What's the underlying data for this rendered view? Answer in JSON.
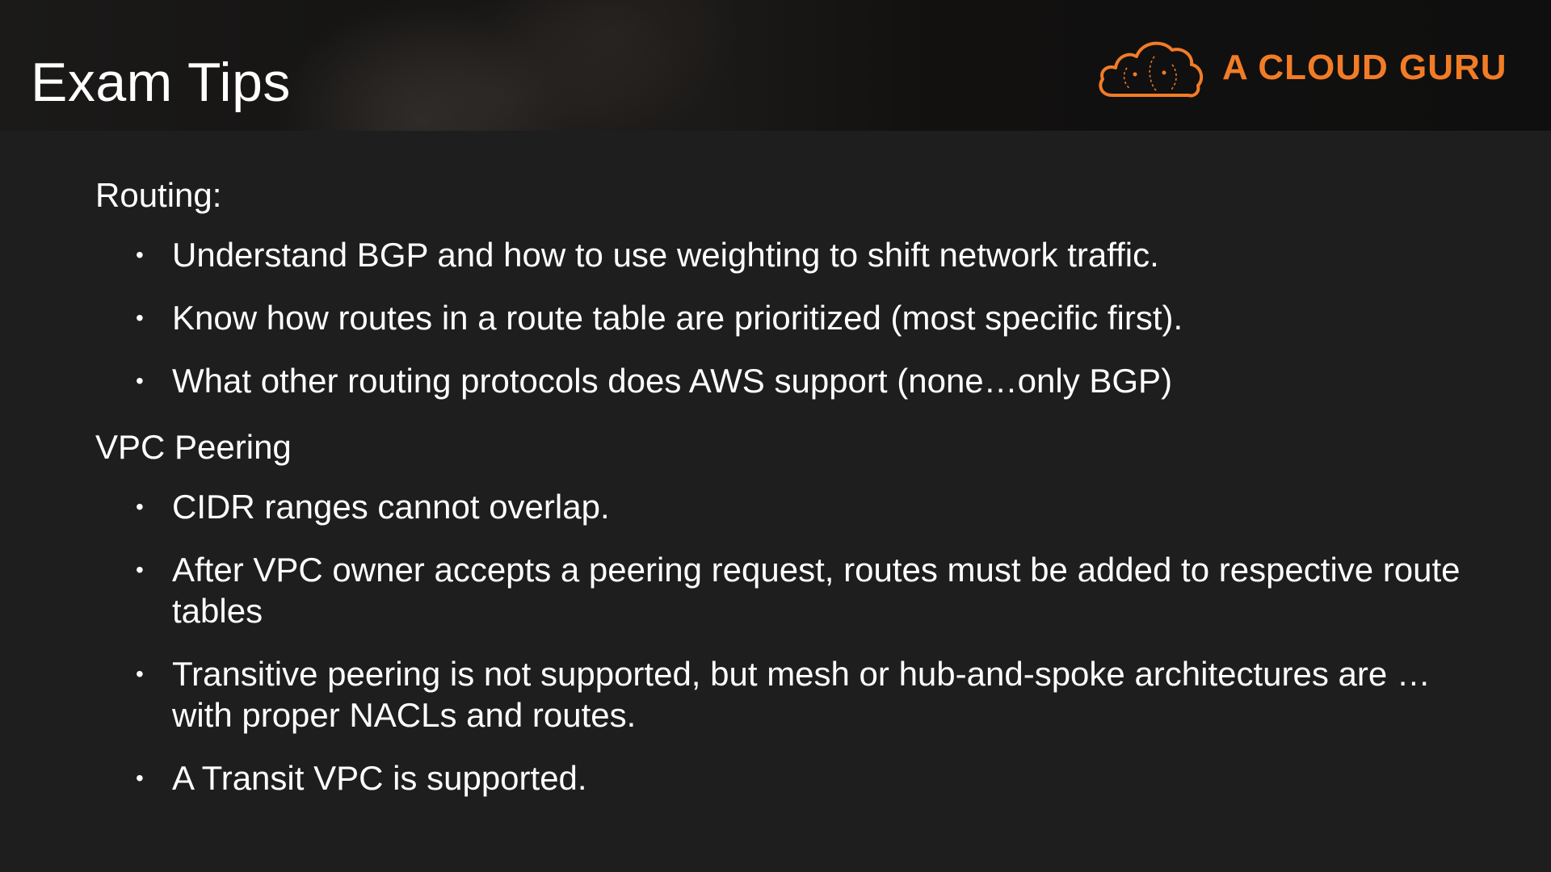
{
  "slide": {
    "title": "Exam Tips",
    "logo": {
      "text": "A CLOUD GURU",
      "icon": "cloud-icon",
      "color": "#f27c26"
    }
  },
  "sections": [
    {
      "heading": "Routing:",
      "bullets": [
        "Understand BGP and how to use weighting to shift network traffic.",
        "Know how routes in a route table are prioritized (most specific first).",
        "What other routing protocols does AWS support (none…only BGP)"
      ]
    },
    {
      "heading": "VPC Peering",
      "bullets": [
        "CIDR ranges cannot overlap.",
        "After VPC owner accepts a peering request, routes must be added to respective route tables",
        "Transitive peering is not supported, but mesh or hub-and-spoke architectures are … with proper NACLs and routes.",
        "A Transit VPC is supported."
      ]
    }
  ],
  "bullet_glyph": "•"
}
